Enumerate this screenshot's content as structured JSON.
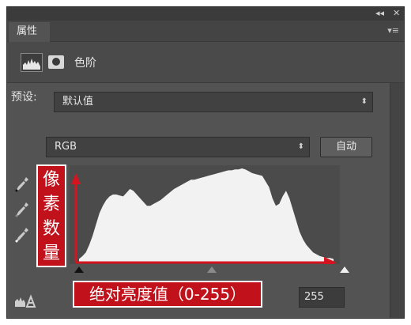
{
  "window": {
    "collapse_glyph": "◂◂",
    "close_glyph": "✕"
  },
  "tab": {
    "label": "属性"
  },
  "panel_menu_glyph": "▾≡",
  "adjustment": {
    "label": "色阶",
    "icons": [
      "levels-histogram-icon",
      "layer-mask-icon"
    ]
  },
  "preset": {
    "label": "预设:",
    "value": "默认值",
    "arrow": "⬍"
  },
  "channel": {
    "value": "RGB",
    "arrow": "⬍"
  },
  "auto_button": {
    "label": "自动"
  },
  "eyedroppers": [
    "black-point-eyedropper-icon",
    "gray-point-eyedropper-icon",
    "white-point-eyedropper-icon"
  ],
  "annotations": {
    "vertical": [
      "像",
      "素",
      "数",
      "量"
    ],
    "horizontal": "绝对亮度值（0-255）",
    "color": "#c1121c"
  },
  "histogram": {
    "channel": "RGB",
    "x_range": [
      0,
      255
    ],
    "levels": [
      3,
      6,
      10,
      18,
      28,
      40,
      52,
      60,
      66,
      70,
      72,
      72,
      71,
      70,
      74,
      78,
      76,
      72,
      68,
      64,
      60,
      60,
      62,
      64,
      66,
      69,
      72,
      75,
      78,
      80,
      82,
      84,
      86,
      88,
      88,
      89,
      90,
      91,
      92,
      93,
      94,
      95,
      96,
      97,
      98,
      98,
      99,
      99,
      100,
      99,
      97,
      95,
      94,
      93,
      92,
      86,
      80,
      68,
      60,
      62,
      70,
      76,
      68,
      56,
      44,
      32,
      24,
      18,
      14,
      10,
      8,
      6,
      5,
      4,
      4,
      3
    ]
  },
  "input_levels": {
    "black": 0,
    "gamma": 1.0,
    "white": 255,
    "white_label": "255"
  }
}
